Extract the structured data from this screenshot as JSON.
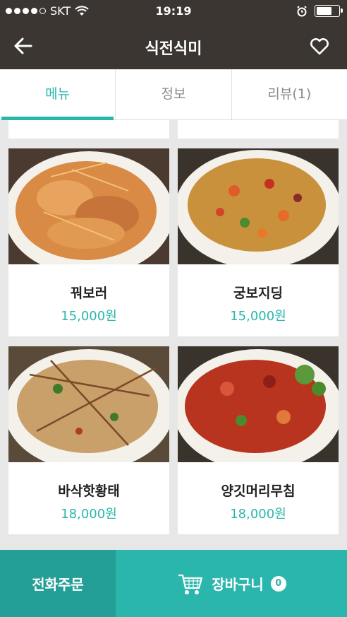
{
  "status": {
    "carrier": "SKT",
    "time": "19:19"
  },
  "header": {
    "title": "식전식미"
  },
  "tabs": [
    {
      "label": "메뉴",
      "active": true
    },
    {
      "label": "정보",
      "active": false
    },
    {
      "label": "리뷰(1)",
      "active": false
    }
  ],
  "menu": [
    {
      "name": "꿔보러",
      "price": "15,000원"
    },
    {
      "name": "궁보지딩",
      "price": "15,000원"
    },
    {
      "name": "바삭핫황태",
      "price": "18,000원"
    },
    {
      "name": "양깃머리무침",
      "price": "18,000원"
    }
  ],
  "bottom": {
    "call_label": "전화주문",
    "cart_label": "장바구니",
    "cart_count": "0"
  },
  "colors": {
    "accent": "#2bb6ad",
    "header_bg": "#3b3631"
  },
  "icons": [
    "back-arrow-icon",
    "heart-icon",
    "wifi-icon",
    "alarm-icon",
    "battery-icon",
    "cart-icon"
  ]
}
